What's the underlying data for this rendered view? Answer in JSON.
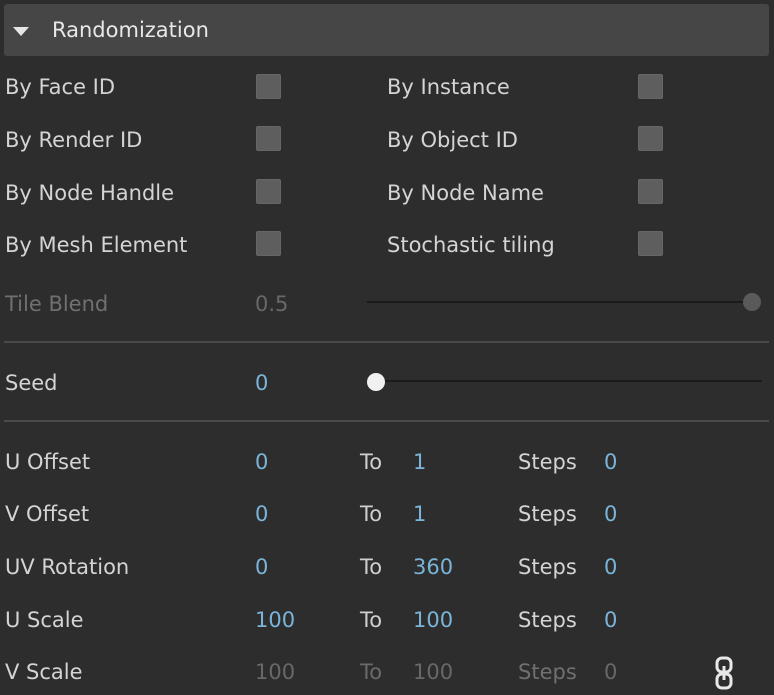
{
  "section": {
    "title": "Randomization"
  },
  "checkboxes": {
    "by_face_id": "By Face ID",
    "by_instance": "By Instance",
    "by_render_id": "By Render ID",
    "by_object_id": "By Object ID",
    "by_node_handle": "By Node Handle",
    "by_node_name": "By Node Name",
    "by_mesh_element": "By Mesh Element",
    "stochastic_tiling": "Stochastic tiling"
  },
  "tile_blend": {
    "label": "Tile Blend",
    "value": "0.5",
    "slider_fraction": 1.0
  },
  "seed": {
    "label": "Seed",
    "value": "0",
    "slider_fraction": 0.0
  },
  "ranges": {
    "to_label": "To",
    "steps_label": "Steps",
    "rows": [
      {
        "label": "U Offset",
        "from": "0",
        "to": "1",
        "steps": "0"
      },
      {
        "label": "V Offset",
        "from": "0",
        "to": "1",
        "steps": "0"
      },
      {
        "label": "UV Rotation",
        "from": "0",
        "to": "360",
        "steps": "0"
      },
      {
        "label": "U Scale",
        "from": "100",
        "to": "100",
        "steps": "0"
      },
      {
        "label": "V Scale",
        "from": "100",
        "to": "100",
        "steps": "0"
      }
    ]
  },
  "icons": {
    "link": "chain-link-icon"
  },
  "colors": {
    "value": "#7ab5d9",
    "header": "#464646",
    "background": "#2d2d2d"
  }
}
